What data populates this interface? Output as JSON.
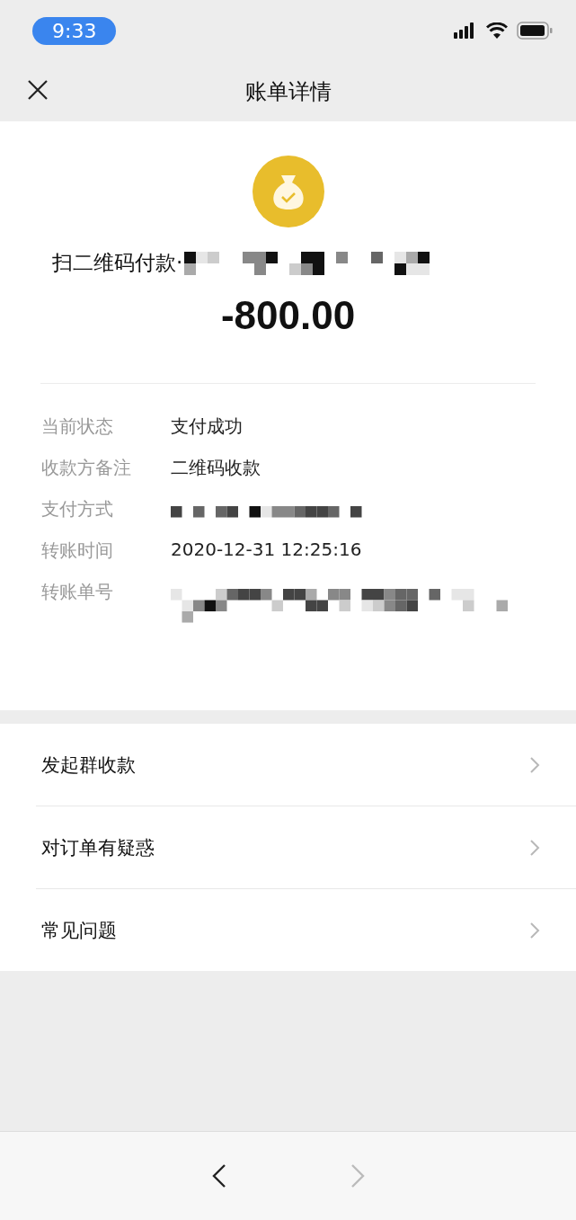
{
  "status_bar": {
    "time": "9:33"
  },
  "nav": {
    "title": "账单详情"
  },
  "summary": {
    "merchant_prefix": "扫二维码付款·",
    "merchant_redacted": true,
    "amount": "-800.00"
  },
  "details": [
    {
      "label": "当前状态",
      "kind": "text",
      "value": "支付成功"
    },
    {
      "label": "收款方备注",
      "kind": "text",
      "value": "二维码收款"
    },
    {
      "label": "支付方式",
      "kind": "redacted"
    },
    {
      "label": "转账时间",
      "kind": "text",
      "value": "2020-12-31 12:25:16"
    },
    {
      "label": "转账单号",
      "kind": "redacted_long"
    }
  ],
  "menu": [
    {
      "label": "发起群收款"
    },
    {
      "label": "对订单有疑惑"
    },
    {
      "label": "常见问题"
    }
  ],
  "toolbar": {
    "back_disabled": false,
    "forward_disabled": true
  }
}
